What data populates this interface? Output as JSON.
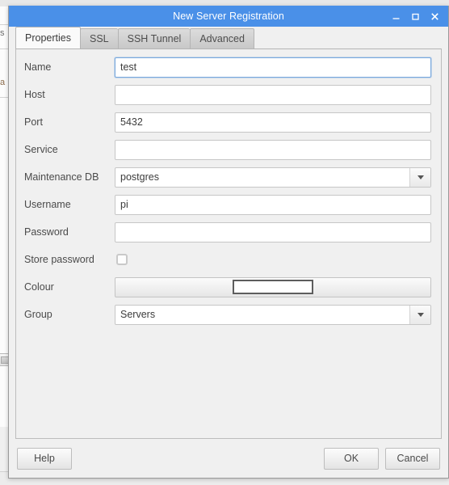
{
  "background_window": {
    "left_fragments": [
      "s",
      "a"
    ]
  },
  "dialog": {
    "title": "New Server Registration",
    "accent_color": "#4a90e8",
    "window_controls": [
      {
        "name": "minimize",
        "glyph": "_"
      },
      {
        "name": "maximize",
        "glyph": "□"
      },
      {
        "name": "close",
        "glyph": "✕"
      }
    ],
    "tabs": [
      {
        "label": "Properties",
        "active": true
      },
      {
        "label": "SSL",
        "active": false
      },
      {
        "label": "SSH Tunnel",
        "active": false
      },
      {
        "label": "Advanced",
        "active": false
      }
    ],
    "form": {
      "name": {
        "label": "Name",
        "value": "test",
        "focused": true
      },
      "host": {
        "label": "Host",
        "value": ""
      },
      "port": {
        "label": "Port",
        "value": "5432"
      },
      "service": {
        "label": "Service",
        "value": ""
      },
      "maintenance_db": {
        "label": "Maintenance DB",
        "value": "postgres"
      },
      "username": {
        "label": "Username",
        "value": "pi"
      },
      "password": {
        "label": "Password",
        "value": ""
      },
      "store_password": {
        "label": "Store password",
        "checked": false
      },
      "colour": {
        "label": "Colour",
        "swatch_color": "#ffffff"
      },
      "group": {
        "label": "Group",
        "value": "Servers"
      }
    },
    "buttons": {
      "help": "Help",
      "ok": "OK",
      "cancel": "Cancel"
    }
  }
}
